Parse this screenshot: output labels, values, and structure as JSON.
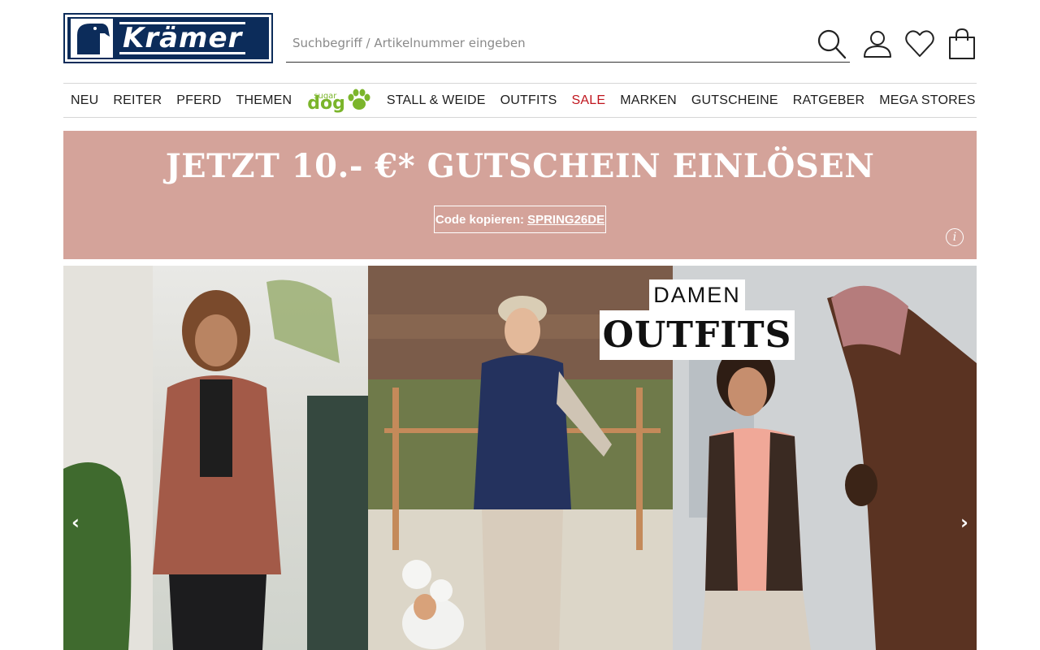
{
  "header": {
    "logo_text": "Krämer",
    "search_placeholder": "Suchbegriff / Artikelnummer eingeben",
    "icons": [
      "search-icon",
      "user-icon",
      "heart-icon",
      "shopping-bag-icon"
    ]
  },
  "nav": {
    "items": [
      "NEU",
      "REITER",
      "PFERD",
      "THEMEN"
    ],
    "sugardog": {
      "small": "sugar",
      "big": "dog"
    },
    "items2": [
      "STALL & WEIDE",
      "OUTFITS",
      "SALE",
      "MARKEN",
      "GUTSCHEINE"
    ],
    "right_items": [
      "RATGEBER",
      "MEGA STORES"
    ],
    "sale_color": "#c0161e"
  },
  "promo": {
    "title": "JETZT 10.- €* GUTSCHEIN EINLÖSEN",
    "code_label": "Code kopieren:",
    "code": "SPRING26DE",
    "background": "#d4a39a"
  },
  "hero": {
    "badge_top": "DAMEN",
    "badge_main": "OUTFITS",
    "prev": "‹",
    "next": "›"
  },
  "colors": {
    "brand": "#0c2c5a",
    "accent_green": "#7bb52b"
  }
}
